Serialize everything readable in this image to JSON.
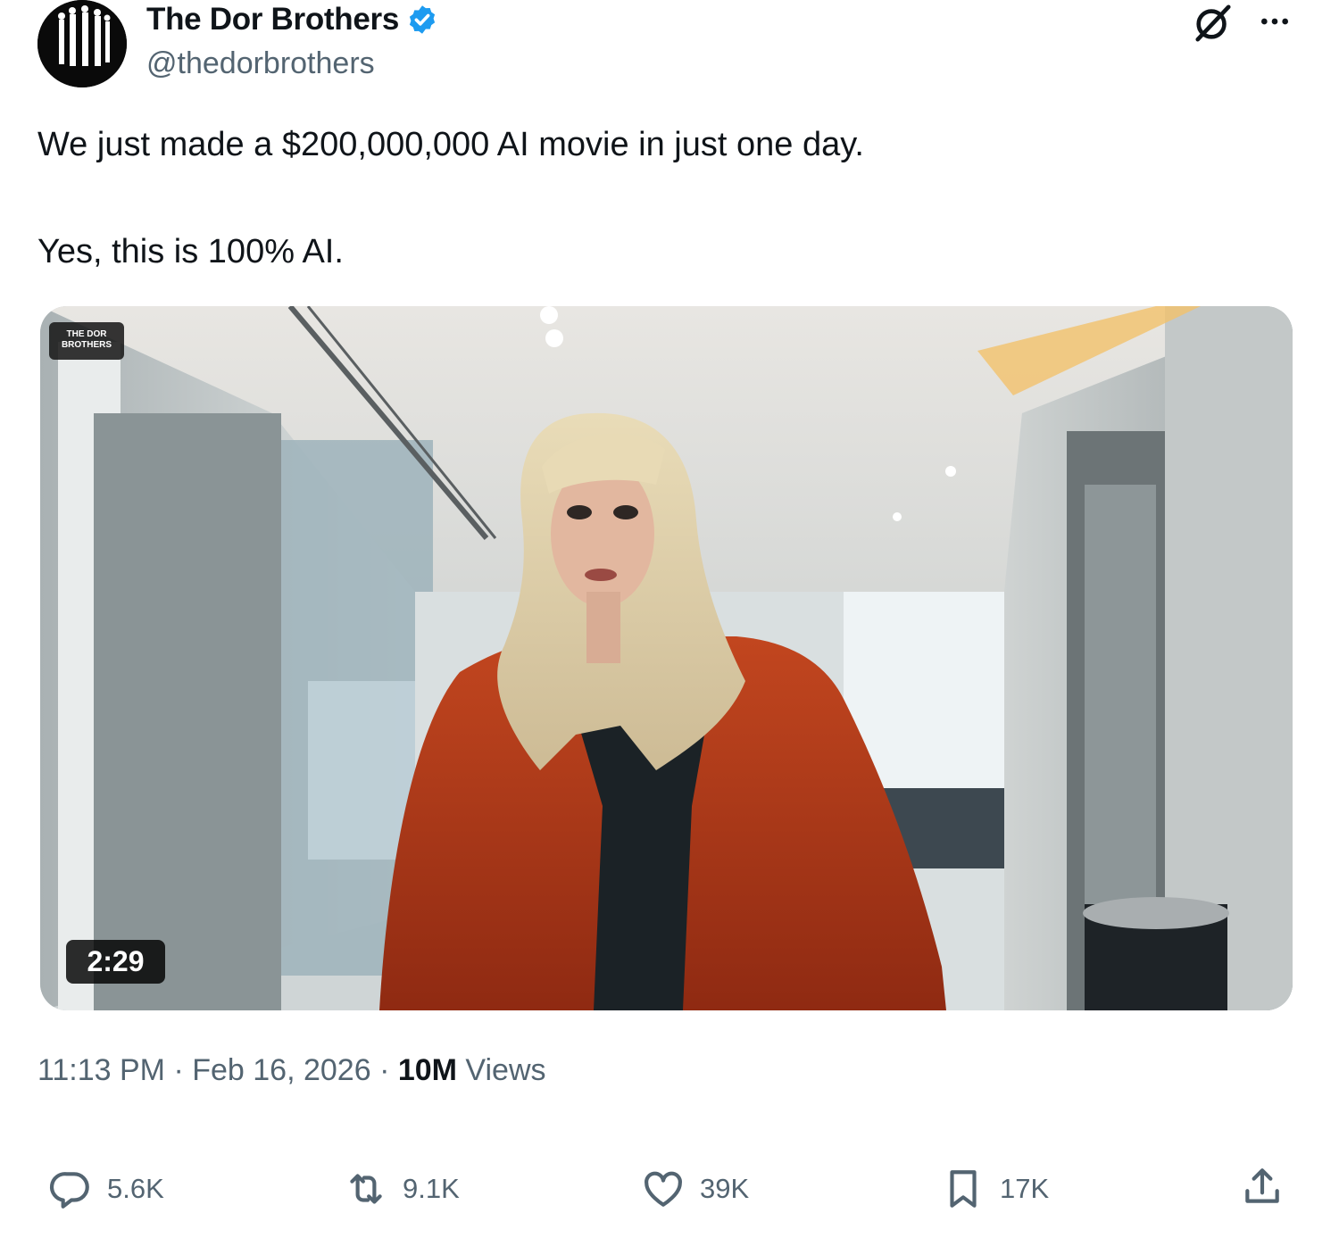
{
  "author": {
    "display_name": "The Dor Brothers",
    "handle": "@thedorbrothers",
    "verified": true
  },
  "tweet": {
    "text_line1": "We just made a $200,000,000 AI movie in just one day.",
    "text_line2": "Yes, this is 100% AI."
  },
  "media": {
    "watermark_line1": "THE DOR",
    "watermark_line2": "BROTHERS",
    "duration": "2:29"
  },
  "meta": {
    "time": "11:13 PM",
    "separator": " · ",
    "date": "Feb 16, 2026",
    "views_count": "10M",
    "views_label": " Views"
  },
  "actions": {
    "replies": "5.6K",
    "reposts": "9.1K",
    "likes": "39K",
    "bookmarks": "17K"
  },
  "icons": [
    "avatar-logo",
    "verified-badge-icon",
    "grok-icon",
    "more-icon",
    "reply-icon",
    "repost-icon",
    "like-icon",
    "bookmark-icon",
    "share-icon"
  ],
  "colors": {
    "verified_blue": "#1d9bf0",
    "secondary_text": "#536471",
    "primary_text": "#0f1419"
  }
}
